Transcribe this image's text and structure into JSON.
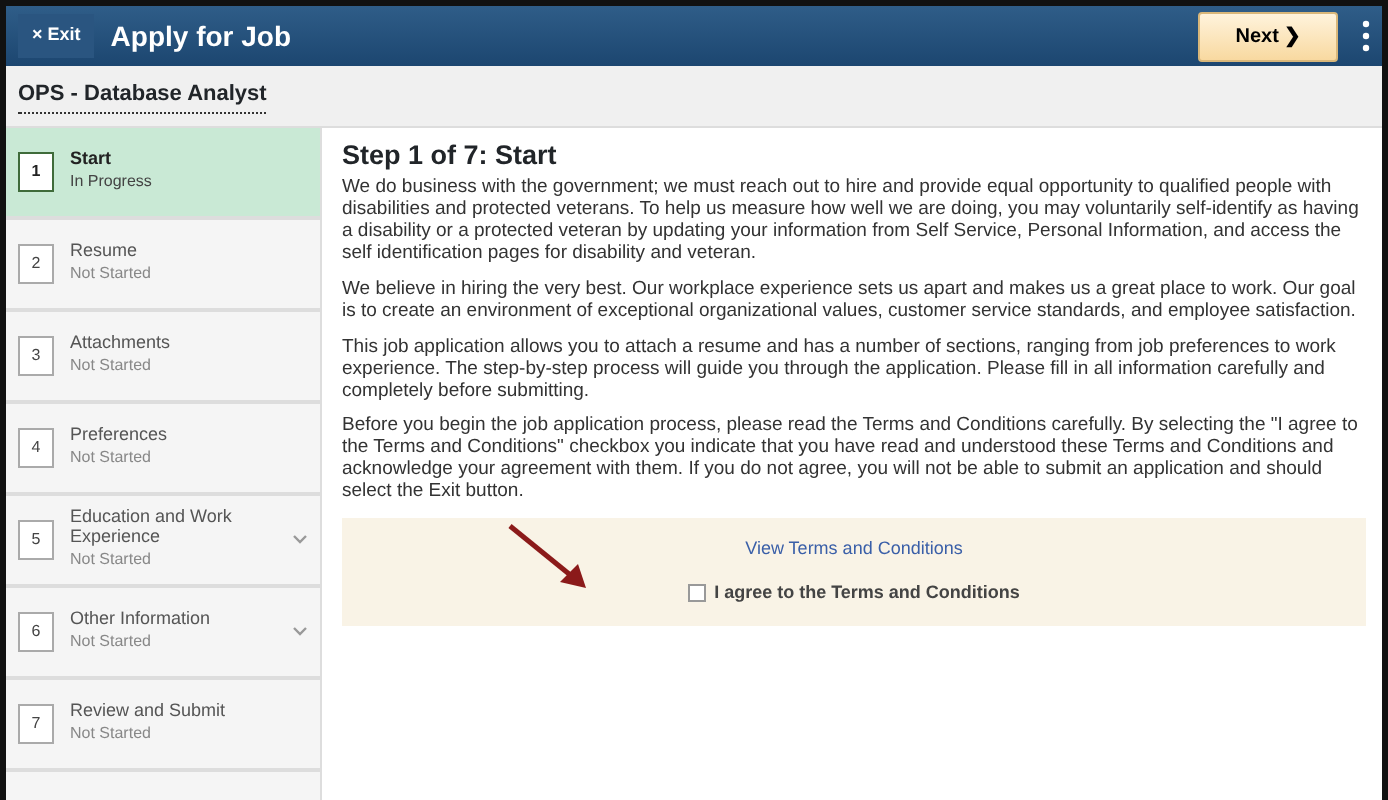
{
  "header": {
    "exit_icon": "×",
    "exit_label": "Exit",
    "title": "Apply for Job",
    "next_label": "Next",
    "next_icon": "❯"
  },
  "job_title": "OPS - Database Analyst",
  "steps": [
    {
      "number": "1",
      "title": "Start",
      "status": "In Progress",
      "selected": true,
      "expandable": false
    },
    {
      "number": "2",
      "title": "Resume",
      "status": "Not Started",
      "selected": false,
      "expandable": false
    },
    {
      "number": "3",
      "title": "Attachments",
      "status": "Not Started",
      "selected": false,
      "expandable": false
    },
    {
      "number": "4",
      "title": "Preferences",
      "status": "Not Started",
      "selected": false,
      "expandable": false
    },
    {
      "number": "5",
      "title": "Education and Work Experience",
      "status": "Not Started",
      "selected": false,
      "expandable": true
    },
    {
      "number": "6",
      "title": "Other Information",
      "status": "Not Started",
      "selected": false,
      "expandable": true
    },
    {
      "number": "7",
      "title": "Review and Submit",
      "status": "Not Started",
      "selected": false,
      "expandable": false
    }
  ],
  "content": {
    "heading": "Step 1 of 7: Start",
    "paragraphs": [
      "We do business with the government; we must reach out to hire and provide equal opportunity to qualified people with disabilities and protected veterans. To help us measure how well we are doing, you may voluntarily self-identify as having a disability or a protected veteran by updating your information from Self Service, Personal Information, and access the self identification pages for disability and veteran.",
      "We believe in hiring the very best. Our workplace experience sets us apart and makes us a great place to work. Our goal is to create an environment of exceptional organizational values, customer service standards, and employee satisfaction.",
      "This job application allows you to attach a resume and has a number of sections, ranging from job preferences to work experience. The step-by-step process will guide you through the application. Please fill in all information carefully and completely before submitting.",
      "Before you begin the job application process, please read the Terms and Conditions carefully. By selecting the \"I agree to the Terms and Conditions\" checkbox you indicate that you have read and understood these Terms and Conditions and acknowledge your agreement with them. If you do not agree, you will not be able to submit an application and should select the Exit button."
    ],
    "terms_link": "View Terms and Conditions",
    "agree": {
      "label": "I agree to the Terms and Conditions",
      "checked": false
    }
  }
}
